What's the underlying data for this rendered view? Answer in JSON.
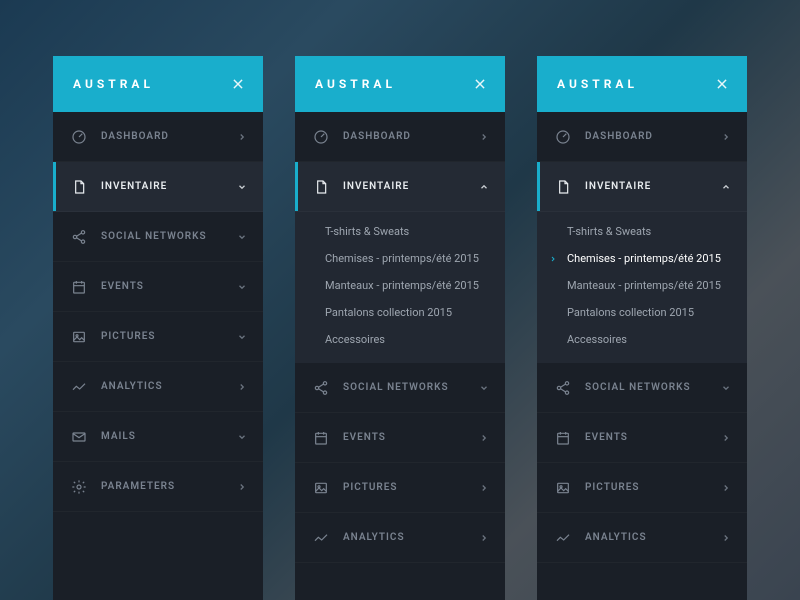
{
  "brand": "AUSTRAL",
  "nav": {
    "dashboard": "DASHBOARD",
    "inventaire": "INVENTAIRE",
    "social": "SOCIAL NETWORKS",
    "events": "EVENTS",
    "pictures": "PICTURES",
    "analytics": "ANALYTICS",
    "mails": "MAILS",
    "parameters": "PARAMETERS"
  },
  "submenu": {
    "tshirts": "T-shirts & Sweats",
    "chemises": "Chemises - printemps/été 2015",
    "manteaux": "Manteaux - printemps/été 2015",
    "pantalons": "Pantalons collection 2015",
    "accessoires": "Accessoires"
  }
}
